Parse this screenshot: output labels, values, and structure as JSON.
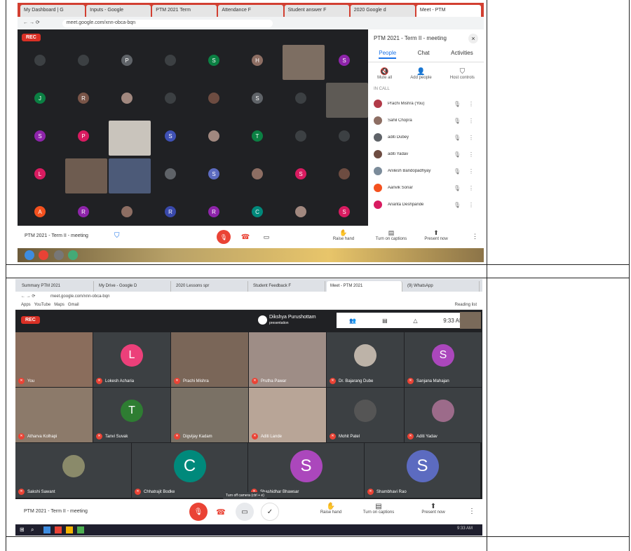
{
  "shot1": {
    "tabs": [
      "My Dashboard | G",
      "Inputs - Google",
      "PTM 2021 Term",
      "Attendance F",
      "Student answer F",
      "2020 Google d",
      "Meet - PTM"
    ],
    "url": "meet.google.com/xnn-obca-bqn",
    "rec_label": "REC",
    "avatars": [
      {
        "letter": "",
        "color": "#3c4043"
      },
      {
        "letter": "",
        "color": "#3c4043"
      },
      {
        "letter": "P",
        "color": "#5f6368"
      },
      {
        "letter": "",
        "color": "#3c4043"
      },
      {
        "letter": "S",
        "color": "#0b8043"
      },
      {
        "letter": "H",
        "color": "#8d6e63"
      },
      {
        "letter": "",
        "color": "#3c4043"
      },
      {
        "letter": "S",
        "color": "#8e24aa"
      },
      {
        "letter": "J",
        "color": "#0b8043"
      },
      {
        "letter": "R",
        "color": "#795548"
      },
      {
        "letter": "",
        "color": "#a1887f"
      },
      {
        "letter": "",
        "color": "#3c4043"
      },
      {
        "letter": "",
        "color": "#6d4c41"
      },
      {
        "letter": "S",
        "color": "#5f6368"
      },
      {
        "letter": "",
        "color": "#3c4043"
      },
      {
        "letter": "",
        "color": "#3c4043"
      },
      {
        "letter": "S",
        "color": "#8e24aa"
      },
      {
        "letter": "P",
        "color": "#d81b60"
      },
      {
        "letter": "",
        "color": "#3c4043"
      },
      {
        "letter": "S",
        "color": "#3f51b5"
      },
      {
        "letter": "",
        "color": "#a1887f"
      },
      {
        "letter": "T",
        "color": "#0b8043"
      },
      {
        "letter": "",
        "color": "#3c4043"
      },
      {
        "letter": "",
        "color": "#3c4043"
      },
      {
        "letter": "L",
        "color": "#d81b60"
      },
      {
        "letter": "",
        "color": "#3c4043"
      },
      {
        "letter": "",
        "color": "#3c4043"
      },
      {
        "letter": "",
        "color": "#5f6368"
      },
      {
        "letter": "S",
        "color": "#5c6bc0"
      },
      {
        "letter": "",
        "color": "#8d6e63"
      },
      {
        "letter": "S",
        "color": "#d81b60"
      },
      {
        "letter": "",
        "color": "#6d4c41"
      },
      {
        "letter": "A",
        "color": "#f4511e"
      },
      {
        "letter": "R",
        "color": "#8e24aa"
      },
      {
        "letter": "",
        "color": "#8d6e63"
      },
      {
        "letter": "R",
        "color": "#3949ab"
      },
      {
        "letter": "R",
        "color": "#8e24aa"
      },
      {
        "letter": "C",
        "color": "#00897b"
      },
      {
        "letter": "",
        "color": "#a1887f"
      },
      {
        "letter": "S",
        "color": "#d81b60"
      }
    ],
    "panel": {
      "title": "PTM 2021 - Term II - meeting",
      "tabs": [
        "People",
        "Chat",
        "Activities"
      ],
      "actions": [
        "Mute all",
        "Add people",
        "Host controls"
      ],
      "section": "IN CALL",
      "people": [
        "Prachi Mishra (You)",
        "Sahil Chopra",
        "aditi Dubey",
        "aditi Yadav",
        "Anilesh Bandopadhyay",
        "Aanvik Sonar",
        "Ananta Deshpande"
      ]
    },
    "bottom": {
      "meeting_name": "PTM 2021 - Term II - meeting",
      "raise_hand": "Raise hand",
      "captions": "Turn on captions",
      "present": "Present now"
    }
  },
  "shot2": {
    "tabs": [
      "Summary PTM 2021",
      "My Drive - Google D",
      "2020 Lessons spr",
      "Student Feedback F",
      "Meet - PTM 2021",
      "(9) WhatsApp"
    ],
    "url": "meet.google.com/xnn-obca-bqn",
    "bookmarks": [
      "Apps",
      "YouTube",
      "Maps",
      "Gmail"
    ],
    "reading_list": "Reading list",
    "rec_label": "REC",
    "presenter": {
      "name": "Dikshya Purushottam",
      "sub": "presentation"
    },
    "time": "9:33 AM",
    "participants": [
      {
        "name": "You",
        "kind": "video",
        "color": "#8a6d5c"
      },
      {
        "name": "Lokesh Acharia",
        "kind": "avatar",
        "letter": "L",
        "color": "#ec407a"
      },
      {
        "name": "Prachi Mishra",
        "kind": "video",
        "color": "#7a6658"
      },
      {
        "name": "Prutha Pawar",
        "kind": "video",
        "color": "#9e8d86"
      },
      {
        "name": "Dr. Bajarang Dube",
        "kind": "photo",
        "color": "#bdb3a8"
      },
      {
        "name": "Sanjana Mahajan",
        "kind": "avatar",
        "letter": "S",
        "color": "#ab47bc"
      },
      {
        "name": "Atharva Kolhapi",
        "kind": "video",
        "color": "#8c7a6a"
      },
      {
        "name": "Tanvi Suvak",
        "kind": "avatar",
        "letter": "T",
        "color": "#2e7d32"
      },
      {
        "name": "Digvijay Kadam",
        "kind": "video",
        "color": "#7a7165"
      },
      {
        "name": "Aditi Lande",
        "kind": "video",
        "color": "#b8a597"
      },
      {
        "name": "Mohit Patel",
        "kind": "photo",
        "color": "#555"
      },
      {
        "name": "Aditi Yadav",
        "kind": "photo",
        "color": "#9c6b8a"
      },
      {
        "name": "Sakshi Sawant",
        "kind": "photo",
        "color": "#8a8a6a"
      },
      {
        "name": "Chhatrajit Bodke",
        "kind": "avatar",
        "letter": "C",
        "color": "#00897b"
      },
      {
        "name": "Shashidhar Bhawsar",
        "kind": "avatar",
        "letter": "S",
        "color": "#ab47bc"
      },
      {
        "name": "Shambhavi Rao",
        "kind": "avatar",
        "letter": "S",
        "color": "#5c6bc0"
      }
    ],
    "bottom": {
      "meeting_name": "PTM 2021 - Term II - meeting",
      "tooltip": "Turn off camera (ctrl + e)",
      "raise_hand": "Raise hand",
      "captions": "Turn on captions",
      "present": "Present now"
    },
    "clock": "9:33 AM"
  },
  "colors": {
    "meet_dark": "#202124",
    "end_call": "#ea4335",
    "accent": "#1a73e8"
  }
}
